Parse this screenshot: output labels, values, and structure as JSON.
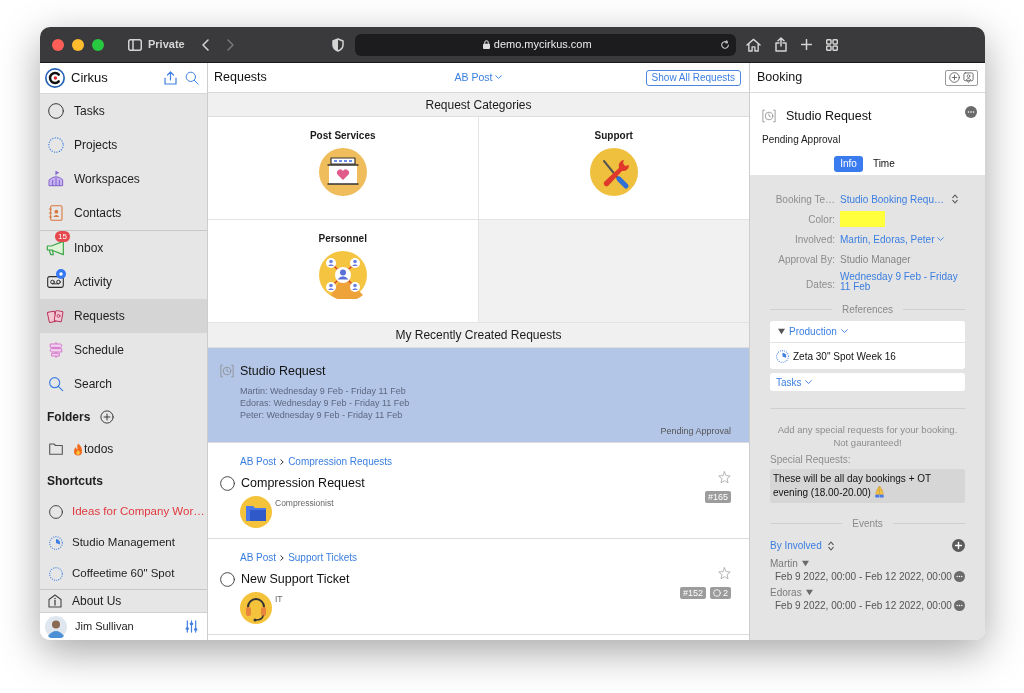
{
  "browser": {
    "private_label": "Private",
    "url": "demo.mycirkus.com"
  },
  "sidebar": {
    "app_name": "Cirkus",
    "nav_groups": [
      [
        {
          "kind": "tasks",
          "label": "Tasks",
          "selected": false,
          "unread": false
        },
        {
          "kind": "projects",
          "label": "Projects",
          "selected": false,
          "unread": false
        },
        {
          "kind": "workspaces",
          "label": "Workspaces",
          "selected": false,
          "unread": false
        },
        {
          "kind": "contacts",
          "label": "Contacts",
          "selected": false,
          "unread": false
        }
      ],
      [
        {
          "kind": "inbox",
          "label": "Inbox",
          "badge": "15",
          "selected": false,
          "unread": false
        },
        {
          "kind": "activity",
          "label": "Activity",
          "selected": false,
          "unread": true
        },
        {
          "kind": "requests",
          "label": "Requests",
          "selected": true,
          "unread": false
        },
        {
          "kind": "schedule",
          "label": "Schedule",
          "selected": false,
          "unread": false
        },
        {
          "kind": "search",
          "label": "Search",
          "selected": false,
          "unread": false
        }
      ]
    ],
    "folders": {
      "title": "Folders",
      "items": [
        {
          "kind": "flame",
          "label": "todos"
        }
      ]
    },
    "shortcuts": {
      "title": "Shortcuts",
      "items": [
        {
          "kind": "task",
          "label": "Ideas for Company Wor…",
          "overdue": true
        },
        {
          "kind": "project_active",
          "label": "Studio Management",
          "overdue": false
        },
        {
          "kind": "project",
          "label": "Coffeetime 60\" Spot",
          "overdue": false
        }
      ]
    },
    "about": {
      "label": "About Us"
    },
    "user": {
      "name": "Jim Sullivan"
    }
  },
  "requests_panel": {
    "title": "Requests",
    "workspace": "AB Post",
    "show_all_button": "Show All Requests",
    "categories_title": "Request Categories",
    "categories": [
      {
        "kind": "post",
        "label": "Post Services"
      },
      {
        "kind": "support",
        "label": "Support"
      },
      {
        "kind": "personnel",
        "label": "Personnel"
      }
    ],
    "recent_title": "My Recently Created Requests",
    "recent": [
      {
        "kind": "booking",
        "selected": true,
        "title": "Studio Request",
        "lines": [
          "Martin: Wednesday 9 Feb - Friday 11 Feb",
          "Edoras: Wednesday 9 Feb - Friday 11 Feb",
          "Peter: Wednesday 9 Feb - Friday 11 Feb"
        ],
        "status": "Pending Approval"
      },
      {
        "kind": "task",
        "selected": false,
        "checked": false,
        "starred": false,
        "breadcrumb": [
          "AB Post",
          "Compression Requests"
        ],
        "title": "Compression Request",
        "category": {
          "kind": "folder",
          "label": "Compressionist"
        },
        "number": "#165"
      },
      {
        "kind": "task",
        "selected": false,
        "checked": false,
        "starred": false,
        "breadcrumb": [
          "AB Post",
          "Support Tickets"
        ],
        "title": "New Support Ticket",
        "category": {
          "kind": "headset",
          "label": "IT"
        },
        "number": "#152",
        "comments": "2"
      }
    ]
  },
  "booking_panel": {
    "title": "Booking",
    "item_title": "Studio Request",
    "status": "Pending Approval",
    "tabs": [
      {
        "label": "Info",
        "selected": true
      },
      {
        "label": "Time",
        "selected": false
      }
    ],
    "fields": [
      {
        "kind": "select",
        "label": "Booking Te…",
        "value": "Studio Booking Requ…"
      },
      {
        "kind": "color",
        "label": "Color:",
        "color": "#ffff3c"
      },
      {
        "kind": "dropdown",
        "label": "Involved:",
        "value": "Martin, Edoras, Peter"
      },
      {
        "kind": "plain",
        "label": "Approval By:",
        "value": "Studio Manager"
      },
      {
        "kind": "link",
        "label": "Dates:",
        "value": "Wednesday 9 Feb - Friday 11 Feb"
      }
    ],
    "references": {
      "title": "References",
      "group": "Production",
      "expanded": true,
      "items": [
        {
          "kind": "project_active",
          "label": "Zeta 30\" Spot Week 16"
        }
      ],
      "tasks_label": "Tasks"
    },
    "note": "Add any special requests for your booking. Not gauranteed!",
    "special_requests": {
      "label": "Special Requests:",
      "value": "These will be all day bookings + OT evening (18.00-20.00)"
    },
    "events": {
      "title": "Events",
      "sort": "By Involved",
      "groups": [
        {
          "name": "Martin",
          "expanded": true,
          "events": [
            "Feb 9 2022, 00:00 - Feb 12 2022, 00:00"
          ]
        },
        {
          "name": "Edoras",
          "expanded": true,
          "events": [
            "Feb 9 2022, 00:00 - Feb 12 2022, 00:00"
          ]
        }
      ]
    }
  }
}
